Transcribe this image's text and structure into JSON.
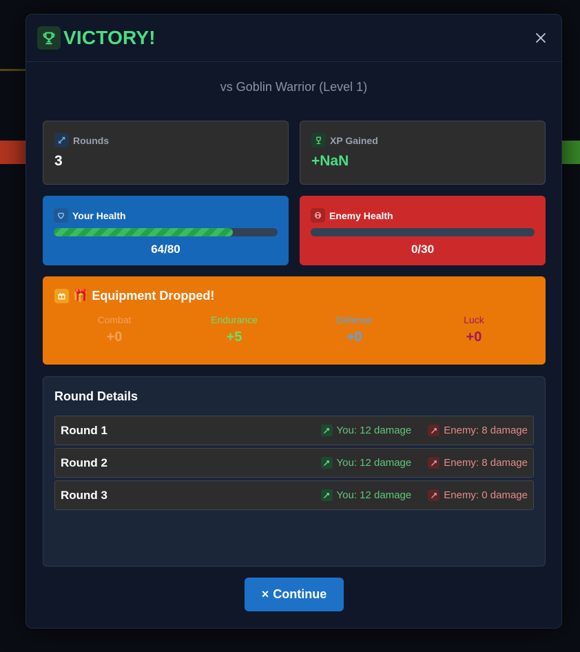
{
  "header": {
    "title": "VICTORY!"
  },
  "subtitle": "vs Goblin Warrior (Level 1)",
  "stats": {
    "rounds_label": "Rounds",
    "rounds_value": "3",
    "xp_label": "XP Gained",
    "xp_value": "+NaN"
  },
  "health": {
    "player_label": "Your Health",
    "player_text": "64/80",
    "player_fraction": 0.8,
    "enemy_label": "Enemy Health",
    "enemy_text": "0/30",
    "enemy_fraction": 0
  },
  "equipment": {
    "title": "🎁 Equipment Dropped!",
    "stats": [
      {
        "label": "Combat",
        "value": "+0",
        "color": "#f5a05a"
      },
      {
        "label": "Endurance",
        "value": "+5",
        "color": "#6ee06a"
      },
      {
        "label": "Defense",
        "value": "+0",
        "color": "#5aa3e8"
      },
      {
        "label": "Luck",
        "value": "+0",
        "color": "#a0165e"
      }
    ]
  },
  "round_details": {
    "title": "Round Details",
    "rounds": [
      {
        "name": "Round 1",
        "you": "You: 12 damage",
        "enemy": "Enemy: 8 damage"
      },
      {
        "name": "Round 2",
        "you": "You: 12 damage",
        "enemy": "Enemy: 8 damage"
      },
      {
        "name": "Round 3",
        "you": "You: 12 damage",
        "enemy": "Enemy: 0 damage"
      }
    ]
  },
  "actions": {
    "continue_label": "Continue"
  },
  "colors": {
    "victory": "#4ade80",
    "player_health_bg": "#1767b8",
    "enemy_health_bg": "#cc2a2a",
    "equipment_bg": "#e97809",
    "you_damage": "#5fc77a",
    "enemy_damage": "#e58a8a"
  }
}
